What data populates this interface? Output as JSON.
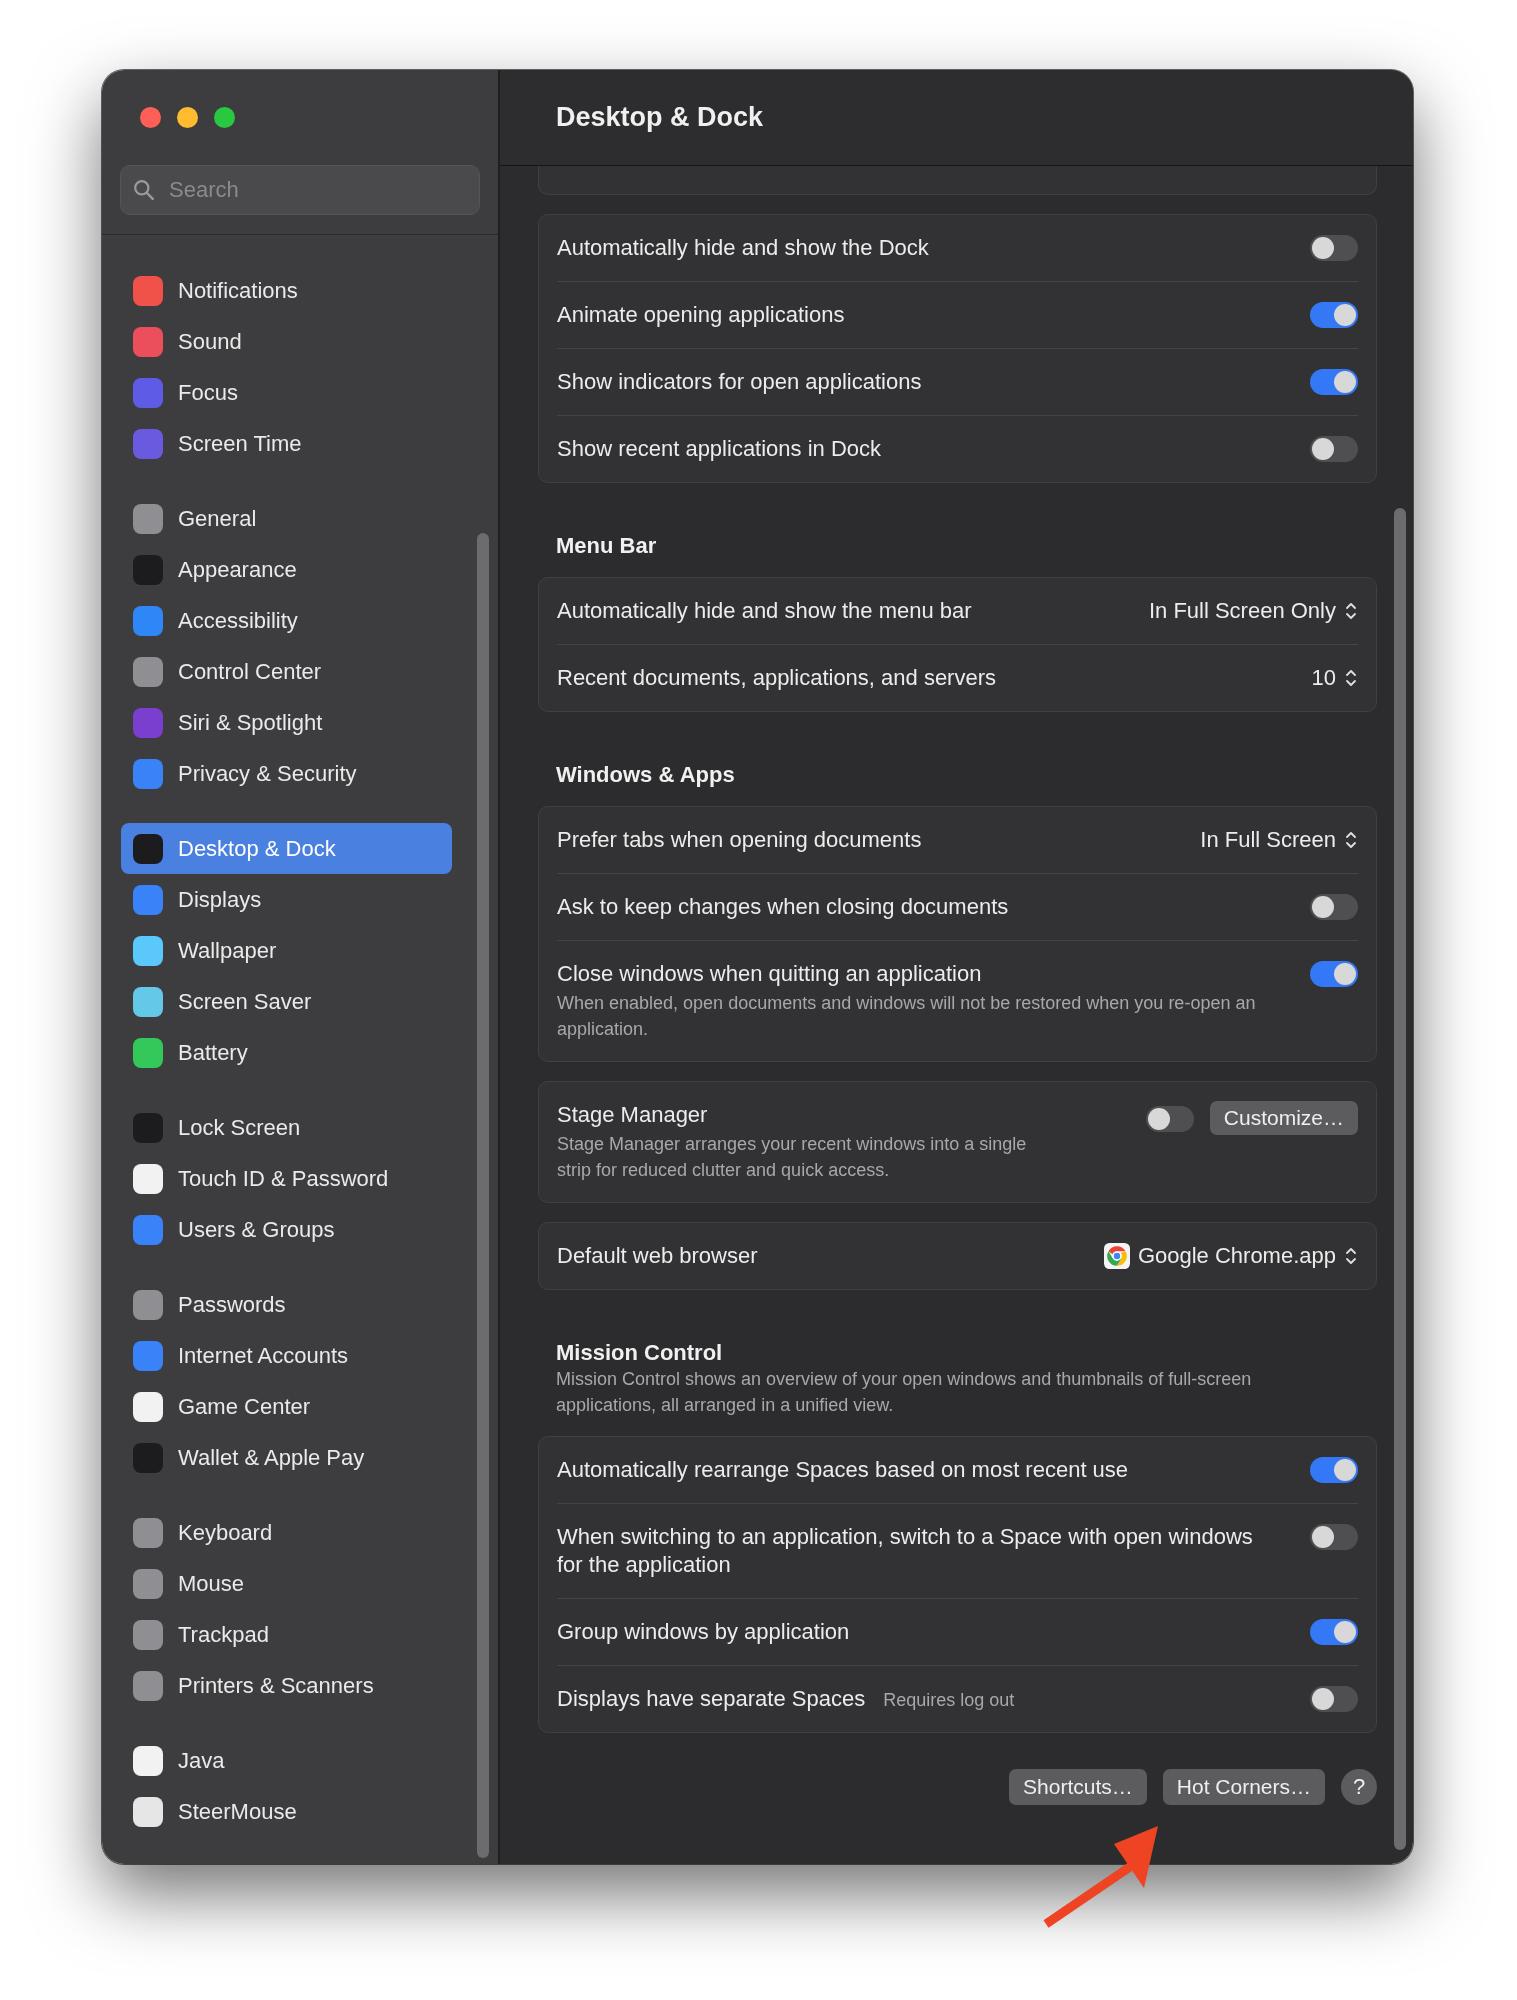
{
  "window": {
    "title": "Desktop & Dock"
  },
  "search": {
    "placeholder": "Search"
  },
  "sidebar": {
    "groups": [
      {
        "items": [
          {
            "label": "Notifications",
            "selected": false,
            "color": "#f0524a"
          },
          {
            "label": "Sound",
            "selected": false,
            "color": "#ec4f5c"
          },
          {
            "label": "Focus",
            "selected": false,
            "color": "#5e5ce6"
          },
          {
            "label": "Screen Time",
            "selected": false,
            "color": "#6a5ae0"
          }
        ]
      },
      {
        "items": [
          {
            "label": "General",
            "selected": false,
            "color": "#8e8e93"
          },
          {
            "label": "Appearance",
            "selected": false,
            "color": "#1c1c1e"
          },
          {
            "label": "Accessibility",
            "selected": false,
            "color": "#2f86f6"
          },
          {
            "label": "Control Center",
            "selected": false,
            "color": "#8e8e93"
          },
          {
            "label": "Siri & Spotlight",
            "selected": false,
            "color": "#7b3fd0"
          },
          {
            "label": "Privacy & Security",
            "selected": false,
            "color": "#3a82f7"
          }
        ]
      },
      {
        "items": [
          {
            "label": "Desktop & Dock",
            "selected": true,
            "color": "#1c1c1e"
          },
          {
            "label": "Displays",
            "selected": false,
            "color": "#3a82f7"
          },
          {
            "label": "Wallpaper",
            "selected": false,
            "color": "#5ac8fa"
          },
          {
            "label": "Screen Saver",
            "selected": false,
            "color": "#64c8e8"
          },
          {
            "label": "Battery",
            "selected": false,
            "color": "#34c759"
          }
        ]
      },
      {
        "items": [
          {
            "label": "Lock Screen",
            "selected": false,
            "color": "#1c1c1e"
          },
          {
            "label": "Touch ID & Password",
            "selected": false,
            "color": "#f2f2f2"
          },
          {
            "label": "Users & Groups",
            "selected": false,
            "color": "#3a82f7"
          }
        ]
      },
      {
        "items": [
          {
            "label": "Passwords",
            "selected": false,
            "color": "#8e8e93"
          },
          {
            "label": "Internet Accounts",
            "selected": false,
            "color": "#3a82f7"
          },
          {
            "label": "Game Center",
            "selected": false,
            "color": "#f2f2f2"
          },
          {
            "label": "Wallet & Apple Pay",
            "selected": false,
            "color": "#1c1c1e"
          }
        ]
      },
      {
        "items": [
          {
            "label": "Keyboard",
            "selected": false,
            "color": "#8e8e93"
          },
          {
            "label": "Mouse",
            "selected": false,
            "color": "#8e8e93"
          },
          {
            "label": "Trackpad",
            "selected": false,
            "color": "#8e8e93"
          },
          {
            "label": "Printers & Scanners",
            "selected": false,
            "color": "#8e8e93"
          }
        ]
      },
      {
        "items": [
          {
            "label": "Java",
            "selected": false,
            "color": "#f2f2f2"
          },
          {
            "label": "SteerMouse",
            "selected": false,
            "color": "#e6e6e6"
          }
        ]
      }
    ]
  },
  "sections": [
    {
      "rows": [
        {
          "kind": "toggle",
          "label": "Automatically hide and show the Dock",
          "on": false
        },
        {
          "kind": "toggle",
          "label": "Animate opening applications",
          "on": true
        },
        {
          "kind": "toggle",
          "label": "Show indicators for open applications",
          "on": true
        },
        {
          "kind": "toggle",
          "label": "Show recent applications in Dock",
          "on": false
        }
      ]
    },
    {
      "heading": "Menu Bar",
      "rows": [
        {
          "kind": "popup",
          "label": "Automatically hide and show the menu bar",
          "value": "In Full Screen Only"
        },
        {
          "kind": "popup",
          "label": "Recent documents, applications, and servers",
          "value": "10"
        }
      ]
    },
    {
      "heading": "Windows & Apps",
      "rows": [
        {
          "kind": "popup",
          "label": "Prefer tabs when opening documents",
          "value": "In Full Screen"
        },
        {
          "kind": "toggle",
          "label": "Ask to keep changes when closing documents",
          "on": false
        },
        {
          "kind": "toggle",
          "label": "Close windows when quitting an application",
          "on": true,
          "description": "When enabled, open documents and windows will not be restored when you re-open an application."
        }
      ]
    },
    {
      "rows": [
        {
          "kind": "toggle-button",
          "label": "Stage Manager",
          "on": false,
          "button": "Customize…",
          "description": "Stage Manager arranges your recent windows into a single strip for reduced clutter and quick access."
        }
      ]
    },
    {
      "rows": [
        {
          "kind": "app-popup",
          "label": "Default web browser",
          "value": "Google Chrome.app"
        }
      ]
    },
    {
      "heading": "Mission Control",
      "description": "Mission Control shows an overview of your open windows and thumbnails of full-screen applications, all arranged in a unified view.",
      "rows": [
        {
          "kind": "toggle",
          "label": "Automatically rearrange Spaces based on most recent use",
          "on": true
        },
        {
          "kind": "toggle",
          "label": "When switching to an application, switch to a Space with open windows for the application",
          "on": false
        },
        {
          "kind": "toggle",
          "label": "Group windows by application",
          "on": true
        },
        {
          "kind": "toggle",
          "label": "Displays have separate Spaces",
          "on": false,
          "note": "Requires log out"
        }
      ]
    }
  ],
  "footer": {
    "buttons": [
      {
        "kind": "push",
        "label": "Shortcuts…"
      },
      {
        "kind": "push",
        "label": "Hot Corners…"
      },
      {
        "kind": "help",
        "label": "?"
      }
    ]
  }
}
